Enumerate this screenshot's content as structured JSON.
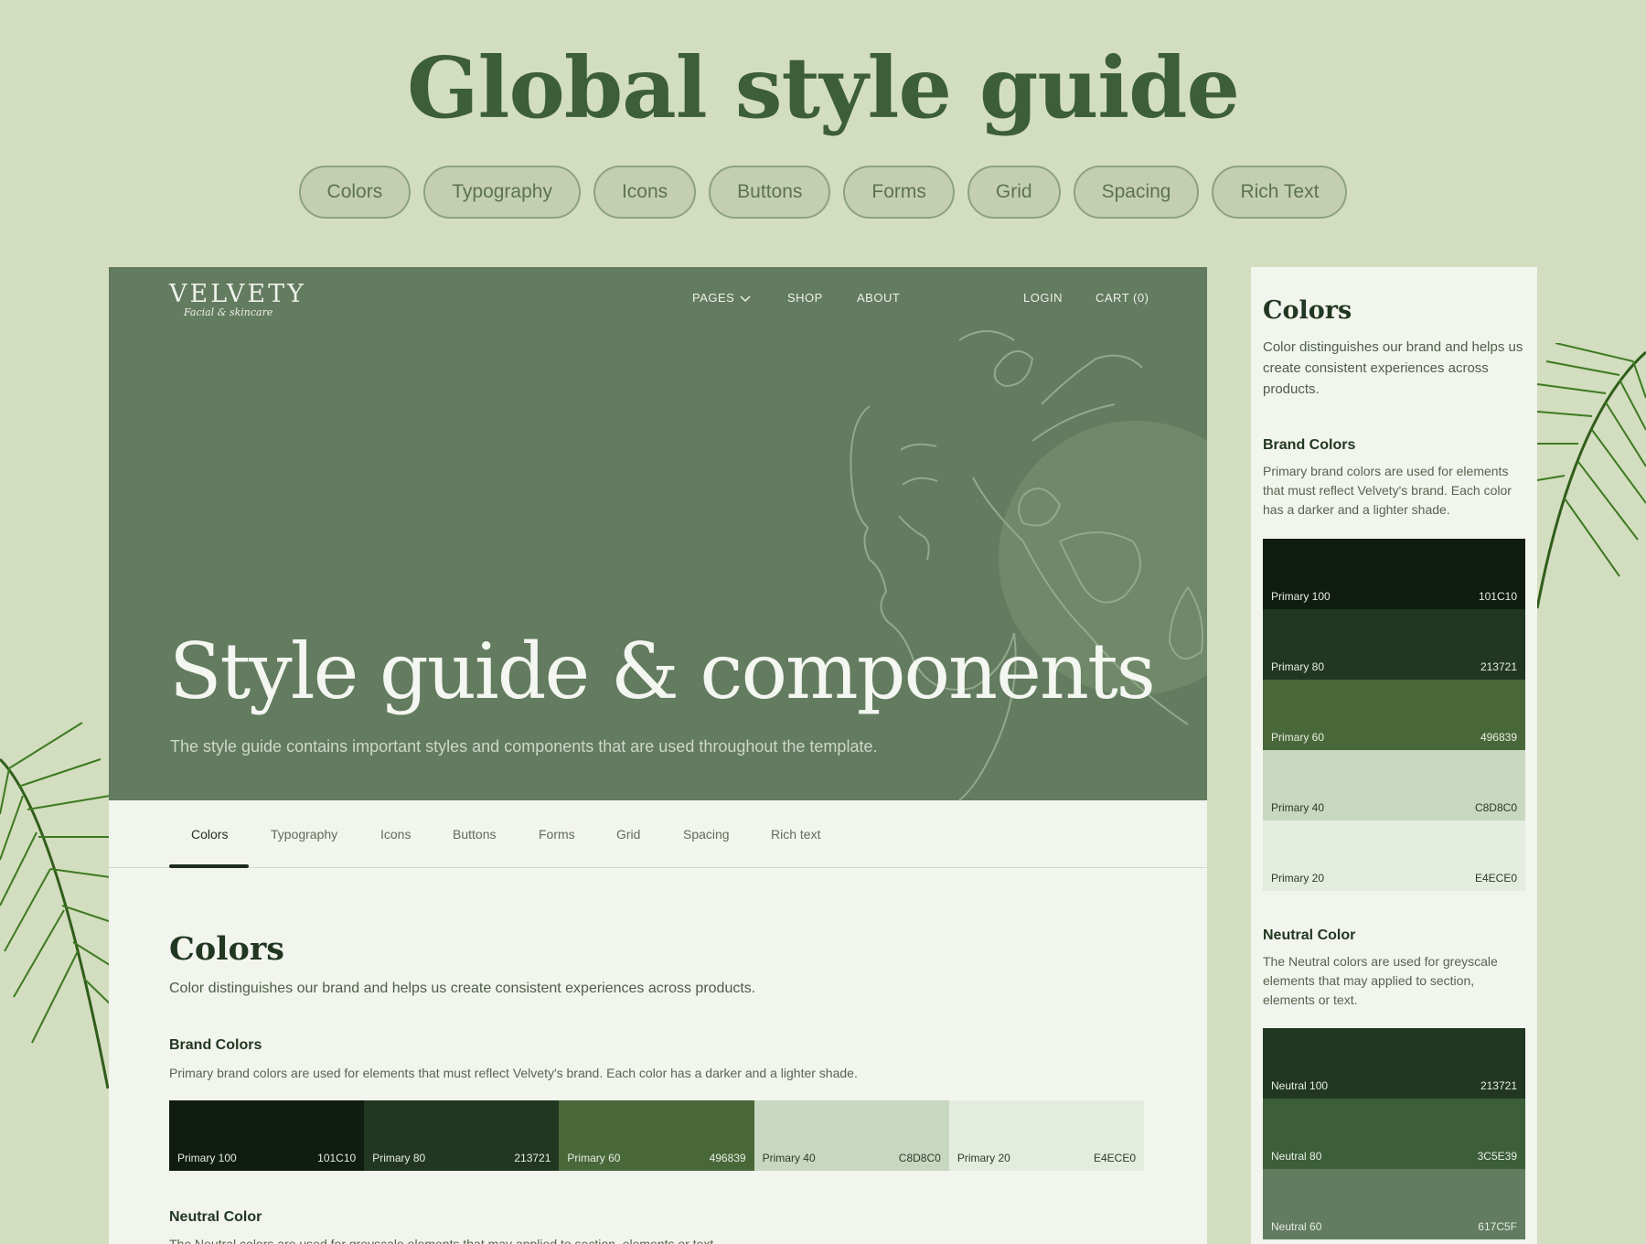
{
  "page_title": "Global style guide",
  "pills": [
    "Colors",
    "Typography",
    "Icons",
    "Buttons",
    "Forms",
    "Grid",
    "Spacing",
    "Rich Text"
  ],
  "logo": {
    "main": "VELVETY",
    "sub": "Facial & skincare"
  },
  "nav": {
    "pages": "PAGES",
    "shop": "SHOP",
    "about": "ABOUT",
    "login": "LOGIN",
    "cart": "CART (0)"
  },
  "hero": {
    "title": "Style guide & components",
    "subtitle": "The style guide contains important styles and components that are used throughout the template."
  },
  "tabs": [
    "Colors",
    "Typography",
    "Icons",
    "Buttons",
    "Forms",
    "Grid",
    "Spacing",
    "Rich text"
  ],
  "colors_section": {
    "title": "Colors",
    "desc": "Color distinguishes our brand and helps us create consistent experiences across products.",
    "brand_title": "Brand Colors",
    "brand_desc": "Primary brand colors are used for elements that must reflect Velvety's brand. Each color has a darker and a lighter shade.",
    "neutral_title": "Neutral Color",
    "neutral_desc": "The Neutral colors are used for greyscale elements that may applied to section, elements or text."
  },
  "brand_swatches": [
    {
      "name": "Primary 100",
      "hex": "101C10",
      "color": "#101c10",
      "text": "#e8ede4"
    },
    {
      "name": "Primary 80",
      "hex": "213721",
      "color": "#213721",
      "text": "#e8ede4"
    },
    {
      "name": "Primary 60",
      "hex": "496839",
      "color": "#496839",
      "text": "#e8ede4"
    },
    {
      "name": "Primary 40",
      "hex": "C8D8C0",
      "color": "#c8d8c0",
      "text": "#2c3b29"
    },
    {
      "name": "Primary 20",
      "hex": "E4ECE0",
      "color": "#e4ece0",
      "text": "#2c3b29"
    }
  ],
  "side": {
    "title": "Colors",
    "desc": "Color distinguishes our brand and helps us create consistent experiences across products.",
    "brand_title": "Brand Colors",
    "brand_desc": "Primary brand colors are used for elements that must reflect Velvety's brand. Each color has a darker and a lighter shade.",
    "neutral_title": "Neutral Color",
    "neutral_desc": "The Neutral colors are used for greyscale elements that may applied to section, elements or text."
  },
  "neutral_swatches": [
    {
      "name": "Neutral 100",
      "hex": "213721",
      "color": "#213721",
      "text": "#e8ede4"
    },
    {
      "name": "Neutral 80",
      "hex": "3C5E39",
      "color": "#3c5e39",
      "text": "#e8ede4"
    },
    {
      "name": "Neutral 60",
      "hex": "617C5F",
      "color": "#617c5f",
      "text": "#e8ede4"
    }
  ]
}
